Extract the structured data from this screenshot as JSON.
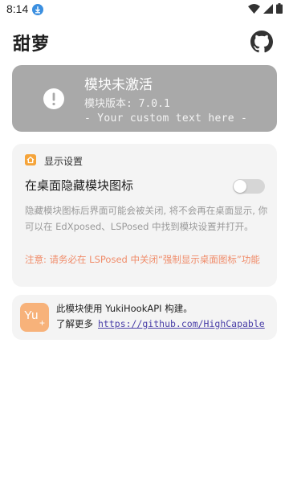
{
  "status_bar": {
    "time": "8:14",
    "icons": [
      "download-icon",
      "wifi-icon",
      "signal-icon",
      "battery-icon"
    ]
  },
  "app": {
    "title": "甜萝"
  },
  "module_status": {
    "title": "模块未激活",
    "version": "模块版本: 7.0.1",
    "custom_text": "- Your custom text here -",
    "color": "#a9a9a9"
  },
  "display_settings": {
    "section_title": "显示设置",
    "toggle_label": "在桌面隐藏模块图标",
    "toggle_on": false,
    "description": "隐藏模块图标后界面可能会被关闭, 将不会再在桌面显示, 你可以在 EdXposed、LSPosed 中找到模块设置并打开。",
    "warning": "注意: 请务必在 LSPosed 中关闭“强制显示桌面图标”功能",
    "accent_color": "#f5a43a",
    "warning_color": "#f08c6a"
  },
  "build_info": {
    "logo_text": "Yu",
    "line1": "此模块使用 YukiHookAPI 构建。",
    "learn_more": "了解更多",
    "link": "https://github.com/HighCapable",
    "link_color": "#4a3fa8"
  }
}
